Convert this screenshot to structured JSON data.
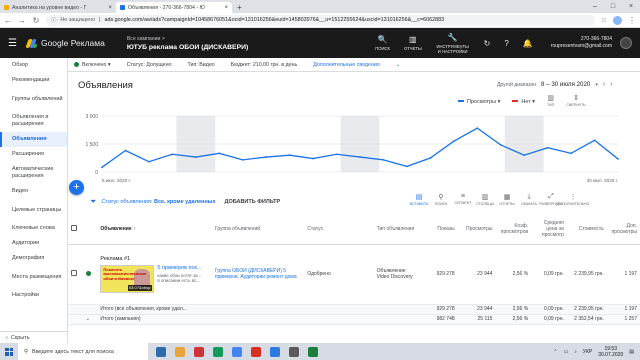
{
  "browser": {
    "tabs": [
      {
        "title": "Аналитика на уровне видео - Г",
        "color": "#f9ab00"
      },
      {
        "title": "Объявления - 270-366-7804 - Ю",
        "color": "#1a73e8"
      }
    ],
    "address": {
      "warning": "Не защищено",
      "url": "ads.google.com/aw/ads?campaignId=10458676051&ocid=131016256&euid=145803976&__u=1512255624&uscid=131016256&__c=6062883"
    }
  },
  "header": {
    "logo": "Google Реклама",
    "campaign_caption": "Все кампании >",
    "campaign_name": "ЮТУБ реклама ОБОИ (ДИСКАВЕРИ)",
    "icons": [
      {
        "name": "search-icon",
        "glyph": "🔍",
        "label": "ПОИСК"
      },
      {
        "name": "reports-icon",
        "glyph": "▥",
        "label": "ОТЧЕТЫ"
      },
      {
        "name": "tools-icon",
        "glyph": "🔧",
        "label": "ИНСТРУМЕНТЫ И НАСТРОЙКИ"
      },
      {
        "name": "refresh-icon",
        "glyph": "↻",
        "label": ""
      },
      {
        "name": "help-icon",
        "glyph": "?",
        "label": ""
      },
      {
        "name": "notifications-icon",
        "glyph": "🔔",
        "label": ""
      }
    ],
    "account_id": "270-366-7804",
    "account_name": "roupresentvam@gmail.com"
  },
  "status": {
    "state": "Включено",
    "campaign_status": "Статус: Допущено",
    "type": "Тип: Видео",
    "budget": "Бюджет: 210,00 грн. в день",
    "more": "Дополнительные сведения"
  },
  "sidebar": {
    "items": [
      {
        "label": "Обзор",
        "lines": 1
      },
      {
        "label": "Рекомендации",
        "lines": 1
      },
      {
        "label": "Группы объявлений",
        "lines": 2
      },
      {
        "label": "Объявления и расширения",
        "lines": 2
      },
      {
        "label": "Объявления",
        "lines": 1,
        "active": true
      },
      {
        "label": "Расширения",
        "lines": 1
      },
      {
        "label": "Автоматические расширения",
        "lines": 2
      },
      {
        "label": "Видео",
        "lines": 1
      },
      {
        "label": "Целевые страницы",
        "lines": 2
      },
      {
        "label": "Ключевые слова",
        "lines": 1
      },
      {
        "label": "Аудитории",
        "lines": 1
      },
      {
        "label": "Демография",
        "lines": 1
      },
      {
        "label": "Места размещения",
        "lines": 2
      },
      {
        "label": "Настройки",
        "lines": 1
      }
    ],
    "bottom": "Скрыть"
  },
  "page": {
    "title": "Объявления",
    "date_label": "Другой диапазон",
    "date_range": "8 – 30 июля 2020"
  },
  "chart_controls": {
    "metric1": "Просмотры",
    "metric1_color": "#1a73e8",
    "metric2": "Нет",
    "metric2_color": "#d93025",
    "ic1": "ТИП",
    "ic2": "СВЕРНУТЬ"
  },
  "chart_data": {
    "type": "line",
    "yticks": [
      "3 000",
      "1 500",
      "0"
    ],
    "ylim": [
      0,
      3000
    ],
    "xlabel_start": "8 июл. 2020 г.",
    "xlabel_end": "30 июл. 2020 г.",
    "values": [
      250,
      1150,
      550,
      950,
      800,
      1000,
      650,
      800,
      900,
      720,
      950,
      800,
      650,
      300,
      750,
      1650,
      2350,
      1450,
      900,
      1300,
      1000,
      1700,
      700
    ],
    "weekend_bands": [
      [
        3,
        5
      ],
      [
        10,
        12
      ],
      [
        17,
        19
      ]
    ]
  },
  "filter": {
    "status": "Статус объявления:",
    "status_value": "Все, кроме удаленных",
    "add": "ДОБАВИТЬ ФИЛЬТР"
  },
  "tools": [
    {
      "g": "▤",
      "label": "ВСТАВИТЬ",
      "active": true
    },
    {
      "g": "⚲",
      "label": "ПОИСК",
      "active": false
    },
    {
      "g": "≡",
      "label": "СЕГМЕНТ",
      "active": false
    },
    {
      "g": "▥",
      "label": "СТОЛБЦЫ",
      "active": false
    },
    {
      "g": "▦",
      "label": "ОТЧЕТЫ",
      "active": false
    },
    {
      "g": "⤓",
      "label": "СКАЧАТЬ",
      "active": false
    },
    {
      "g": "⤢",
      "label": "РАЗВЕРНУТЬ",
      "active": false
    },
    {
      "g": "⋮",
      "label": "ДОПОЛНИТЕЛЬНО",
      "active": false
    }
  ],
  "table": {
    "headers": [
      "Объявление ↑",
      "Группа объявлений",
      "Статус",
      "Тип объявления",
      "Показы",
      "Просмотры",
      "Коэф. просмотров",
      "Средняя цена за просмотр",
      "Стоимость",
      "Доп. просмотры"
    ],
    "ad": {
      "title": "Реклама #1",
      "thumb_text": "Поклеить высококачественные обои в Ижевске",
      "duration": "03:07&nbsp;",
      "headline": "5 примеров пок...",
      "desc": "какие обои хотят за... в описании есть вс...",
      "group": "Группа ОБОИ (ДИСКАВЕРИ) 5 примеров. Аудитории ремонт дома",
      "status": "Одобрено",
      "type": "Объявление Video Discovery",
      "impr": "929 278",
      "views": "23 944",
      "rate": "2,56 %",
      "cpv": "0,09 грн.",
      "cost": "2 239,95 грн.",
      "extra": "1 197"
    },
    "total1": {
      "label": "Итого (все объявления, кроме удал...",
      "impr": "929 278",
      "views": "23 944",
      "rate": "2,56 %",
      "cpv": "0,09 грн.",
      "cost": "2 239,95 грн.",
      "extra": "1 197"
    },
    "total2": {
      "label": "Итого (кампания)",
      "impr": "982 748",
      "views": "25 115",
      "rate": "2,56 %",
      "cpv": "0,09 грн.",
      "cost": "2 352,54 грн.",
      "extra": "1 257"
    }
  },
  "taskbar": {
    "search": "Введите здесь текст для поиска",
    "lang": "УКР",
    "time": "19:53",
    "date": "30.07.2020",
    "apps": [
      "#2b6cb0",
      "#e8a33d",
      "#d13438",
      "#0f9d58",
      "#4285f4",
      "#d93025",
      "#2c7be5",
      "#5a5a5a",
      "#188038"
    ]
  }
}
